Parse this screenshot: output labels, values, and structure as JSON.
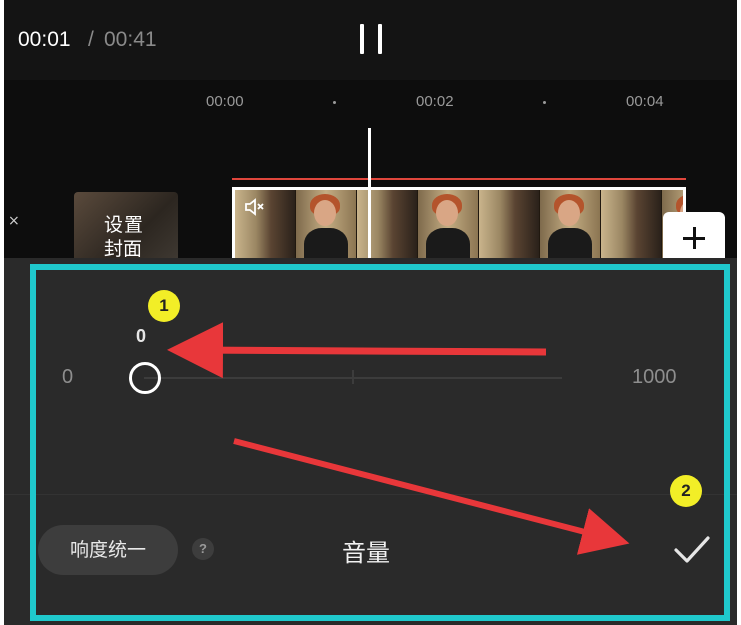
{
  "header": {
    "current_time": "00:01",
    "separator": "/",
    "total_time": "00:41"
  },
  "timeline": {
    "ruler": [
      "00:00",
      "00:02",
      "00:04"
    ],
    "close_symbol": "×",
    "cover_label_line1": "设置",
    "cover_label_line2": "封面",
    "add_symbol": "+"
  },
  "volume_panel": {
    "current_value": "0",
    "min_label": "0",
    "max_label": "1000",
    "slider_fraction": 0,
    "loudness_button": "响度统一",
    "help_symbol": "?",
    "title": "音量"
  },
  "annotations": {
    "badges": [
      "1",
      "2"
    ],
    "highlight_color": "#1fc8cc",
    "arrow_color": "#e8373a",
    "badge_color": "#f2ee27"
  },
  "icons": [
    "pause-icon",
    "mute-icon",
    "add-icon",
    "help-icon",
    "check-icon",
    "close-icon"
  ]
}
